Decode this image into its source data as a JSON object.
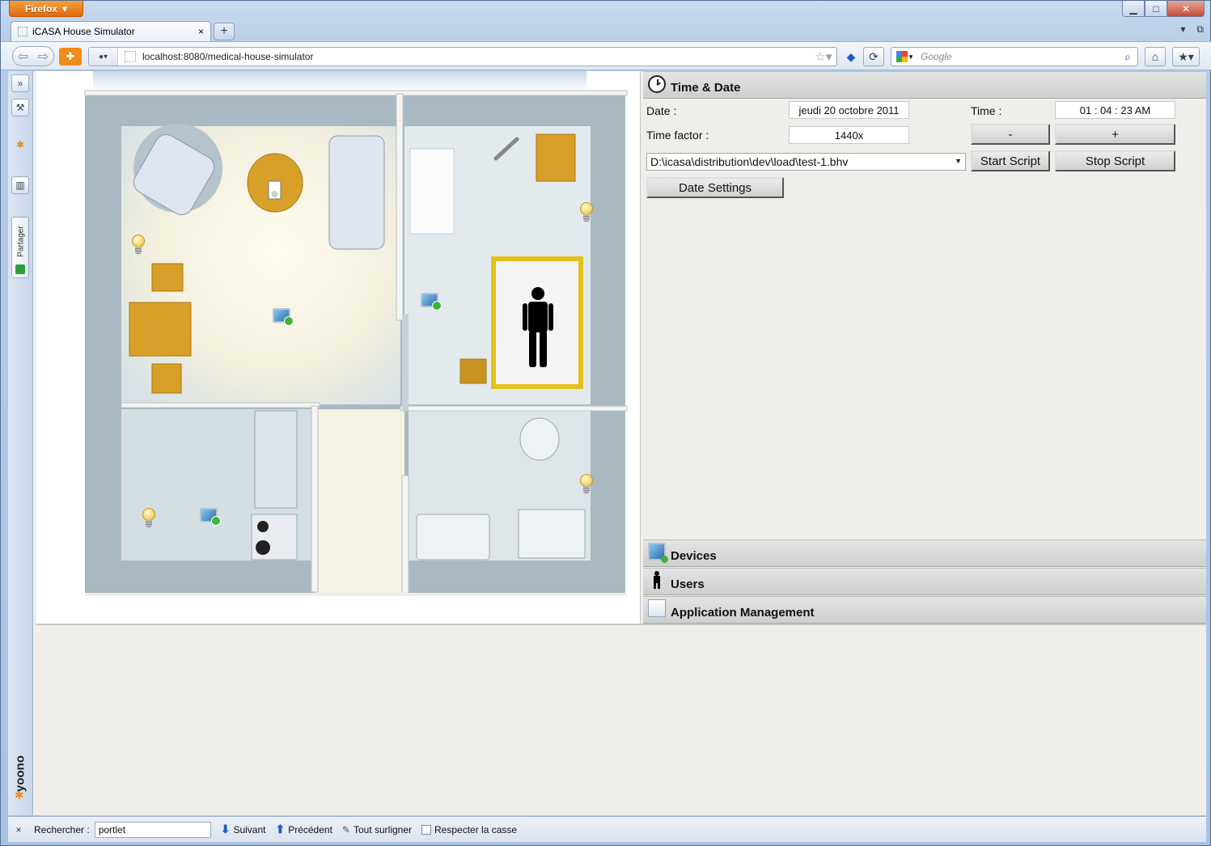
{
  "window": {
    "firefox_button": "Firefox",
    "controls": {
      "minimize": "▁",
      "maximize": "□",
      "close": "✕"
    }
  },
  "tab": {
    "title": "iCASA House Simulator",
    "close": "×",
    "new_tab": "+"
  },
  "nav": {
    "url": "localhost:8080/medical-house-simulator",
    "search_placeholder": "Google"
  },
  "sidebar": {
    "partager": "Partager",
    "yoono": "yoono"
  },
  "panel": {
    "time_date": {
      "header": "Time & Date",
      "date_label": "Date :",
      "date_value": "jeudi 20 octobre 2011",
      "time_label": "Time :",
      "time_value": "01 : 04 : 23 AM",
      "time_factor_label": "Time factor :",
      "time_factor_value": "1440x",
      "minus_label": "-",
      "plus_label": "+",
      "script_selected": "D:\\icasa\\distribution\\dev\\load\\test-1.bhv",
      "start_script": "Start Script",
      "stop_script": "Stop Script",
      "date_settings": "Date Settings"
    },
    "devices_header": "Devices",
    "users_header": "Users",
    "app_mgmt_header": "Application Management"
  },
  "findbar": {
    "close": "×",
    "label": "Rechercher :",
    "value": "portlet",
    "next": "Suivant",
    "prev": "Précédent",
    "highlight": "Tout surligner",
    "match_case": "Respecter la casse"
  }
}
